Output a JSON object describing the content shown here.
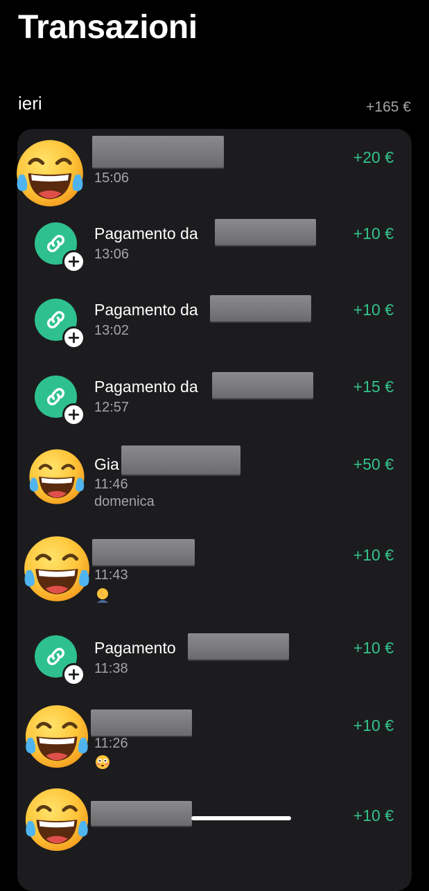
{
  "header": {
    "title": "Transazioni"
  },
  "section": {
    "label": "ieri",
    "total": "+165 €"
  },
  "transactions": [
    {
      "icon": "laughing-tears-emoji",
      "name": "",
      "time": "15:06",
      "note": "",
      "amount": "+20 €"
    },
    {
      "icon": "payment-link-icon",
      "name": "Pagamento da",
      "time": "13:06",
      "note": "",
      "amount": "+10 €"
    },
    {
      "icon": "payment-link-icon",
      "name": "Pagamento da",
      "time": "13:02",
      "note": "",
      "amount": "+10 €"
    },
    {
      "icon": "payment-link-icon",
      "name": "Pagamento da",
      "time": "12:57",
      "note": "",
      "amount": "+15 €"
    },
    {
      "icon": "laughing-tears-emoji",
      "name": "Gia",
      "time": "11:46",
      "note": "domenica",
      "amount": "+50 €"
    },
    {
      "icon": "laughing-tears-emoji",
      "name": "",
      "time": "11:43",
      "note_emoji": "facepalm-emoji",
      "amount": "+10 €"
    },
    {
      "icon": "payment-link-icon",
      "name": "Pagamento",
      "time": "11:38",
      "note": "",
      "amount": "+10 €"
    },
    {
      "icon": "laughing-tears-emoji",
      "name": "",
      "time": "11:26",
      "note_emoji": "flushed-face-emoji",
      "amount": "+10 €"
    },
    {
      "icon": "laughing-tears-emoji",
      "name": "",
      "time": "",
      "note": "",
      "amount": "+10 €"
    }
  ],
  "colors": {
    "background": "#000000",
    "card": "#1c1c1e",
    "amount": "#34c38a",
    "link_icon": "#2ec18f",
    "secondary_text": "#a5a5a8"
  }
}
